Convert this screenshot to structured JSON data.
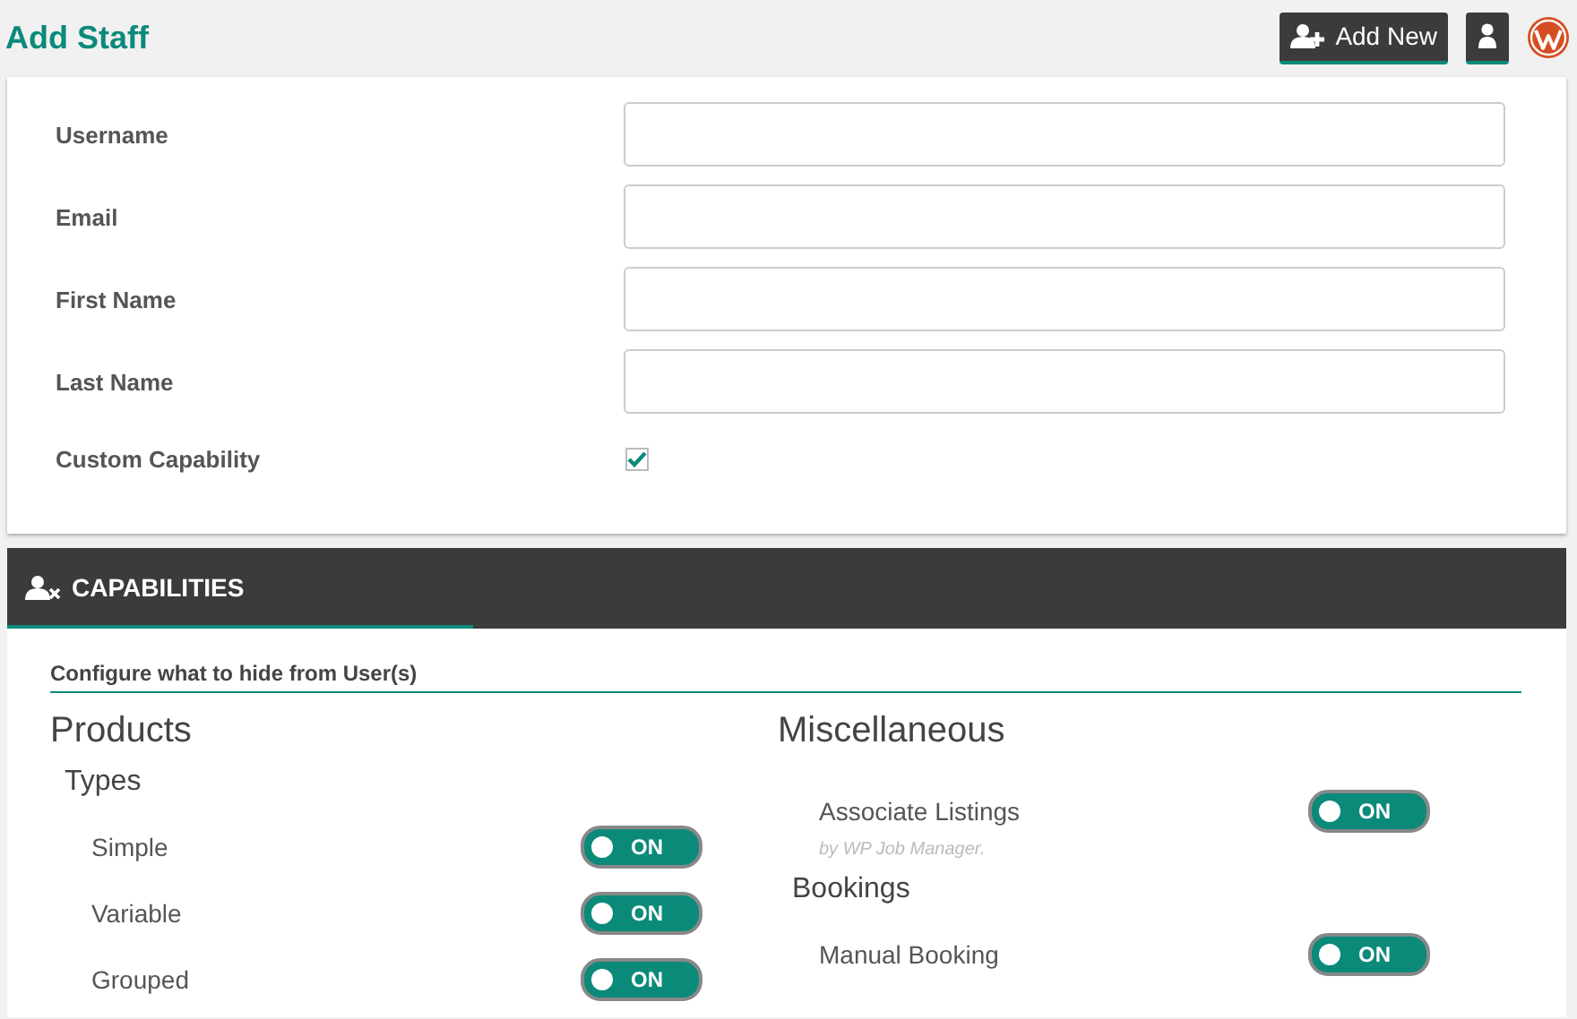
{
  "header": {
    "title": "Add Staff",
    "add_button": "Add New"
  },
  "form": {
    "fields": [
      {
        "label": "Username"
      },
      {
        "label": "Email"
      },
      {
        "label": "First Name"
      },
      {
        "label": "Last Name"
      }
    ],
    "custom_capability": {
      "label": "Custom Capability",
      "checked": true
    }
  },
  "capabilities": {
    "title": "CAPABILITIES",
    "subtitle": "Configure what to hide from User(s)",
    "columns": [
      {
        "heading": "Products",
        "groups": [
          {
            "title": "Types",
            "items": [
              {
                "label": "Simple",
                "on": true,
                "state_label": "ON"
              },
              {
                "label": "Variable",
                "on": true,
                "state_label": "ON"
              },
              {
                "label": "Grouped",
                "on": true,
                "state_label": "ON"
              }
            ]
          }
        ]
      },
      {
        "heading": "Miscellaneous",
        "groups": [
          {
            "items": [
              {
                "label": "Associate Listings",
                "on": true,
                "state_label": "ON",
                "note": "by WP Job Manager."
              }
            ]
          },
          {
            "title": "Bookings",
            "items": [
              {
                "label": "Manual Booking",
                "on": true,
                "state_label": "ON"
              }
            ]
          }
        ]
      }
    ]
  }
}
